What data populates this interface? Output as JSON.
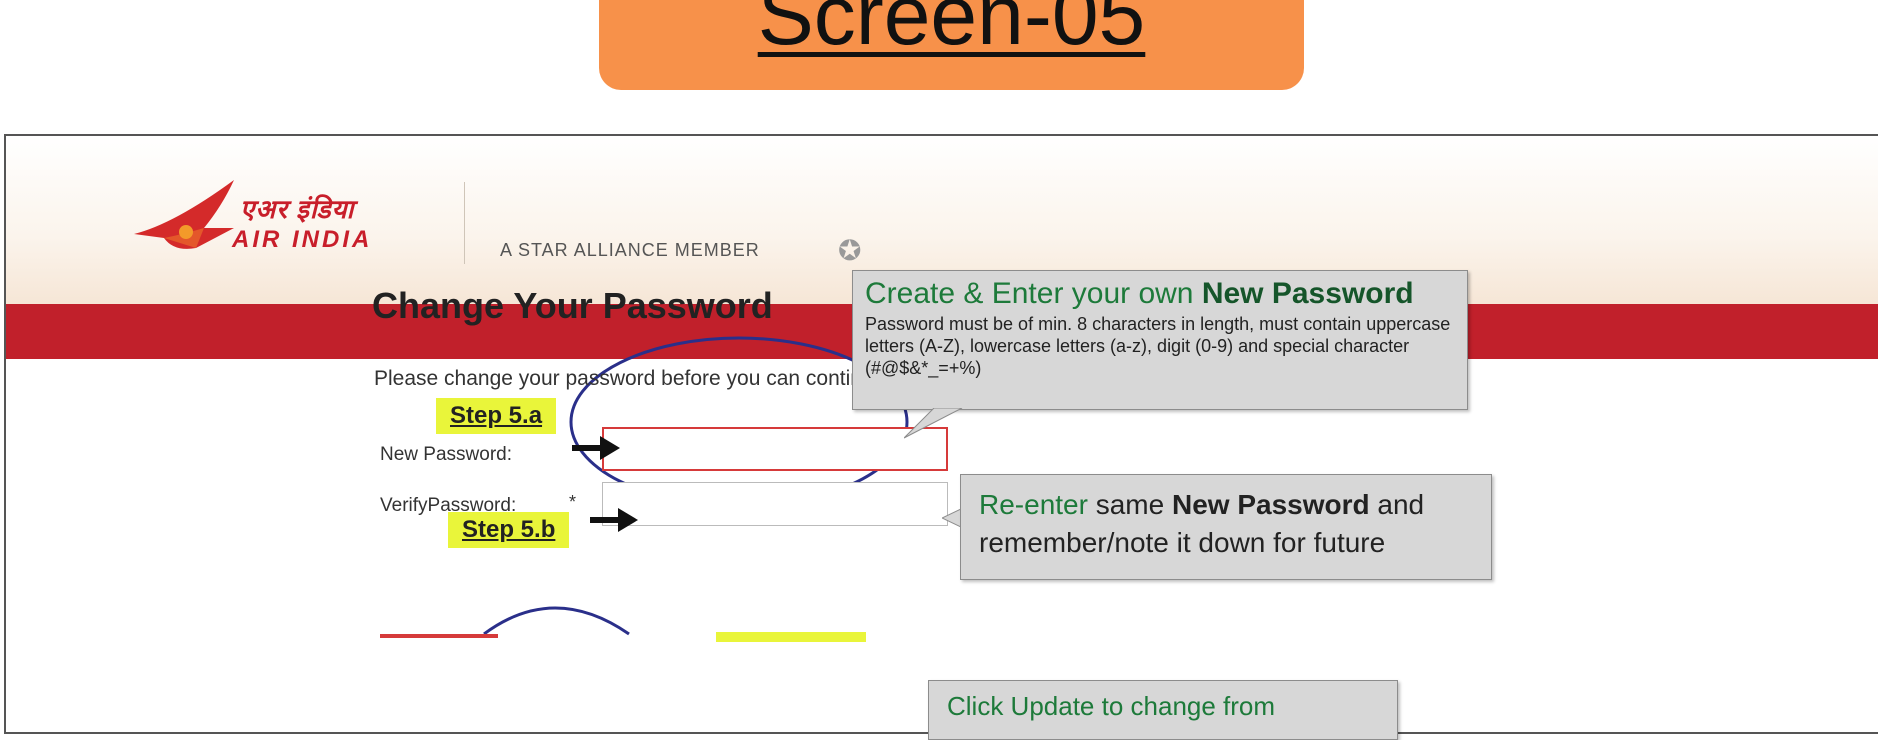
{
  "screen_label": "Screen-05",
  "header": {
    "logo_hindi": "एअर इंडिया",
    "logo_english": "AIR INDIA",
    "tagline": "A STAR ALLIANCE MEMBER",
    "star_icon": "star-alliance-icon",
    "brand_red": "#c1202b"
  },
  "form": {
    "title": "Change Your Password",
    "instructions": "Please change your password before you can continue",
    "new_password_label": "New Password:",
    "verify_password_label": "VerifyPassword:",
    "required_marker": "*",
    "new_password_value": "",
    "verify_password_value": ""
  },
  "annotations": {
    "step_a": "Step 5.a",
    "step_b": "Step 5.b",
    "callout1": {
      "title_prefix": "Create & Enter your own ",
      "title_bold": "New Password",
      "body": "Password must be of min. 8 characters in length, must contain uppercase letters (A-Z), lowercase  letters (a-z), digit (0-9) and special character (#@$&*_=+%)"
    },
    "callout2": {
      "prefix": "Re-enter",
      "middle": " same ",
      "bold": "New Password",
      "suffix": " and",
      "line2": "remember/note it down for future"
    },
    "callout3_partial": "Click Update to change from",
    "badge_color": "#f7914a",
    "step_color": "#e9f53a",
    "ellipse_color": "#2a2f8a"
  }
}
